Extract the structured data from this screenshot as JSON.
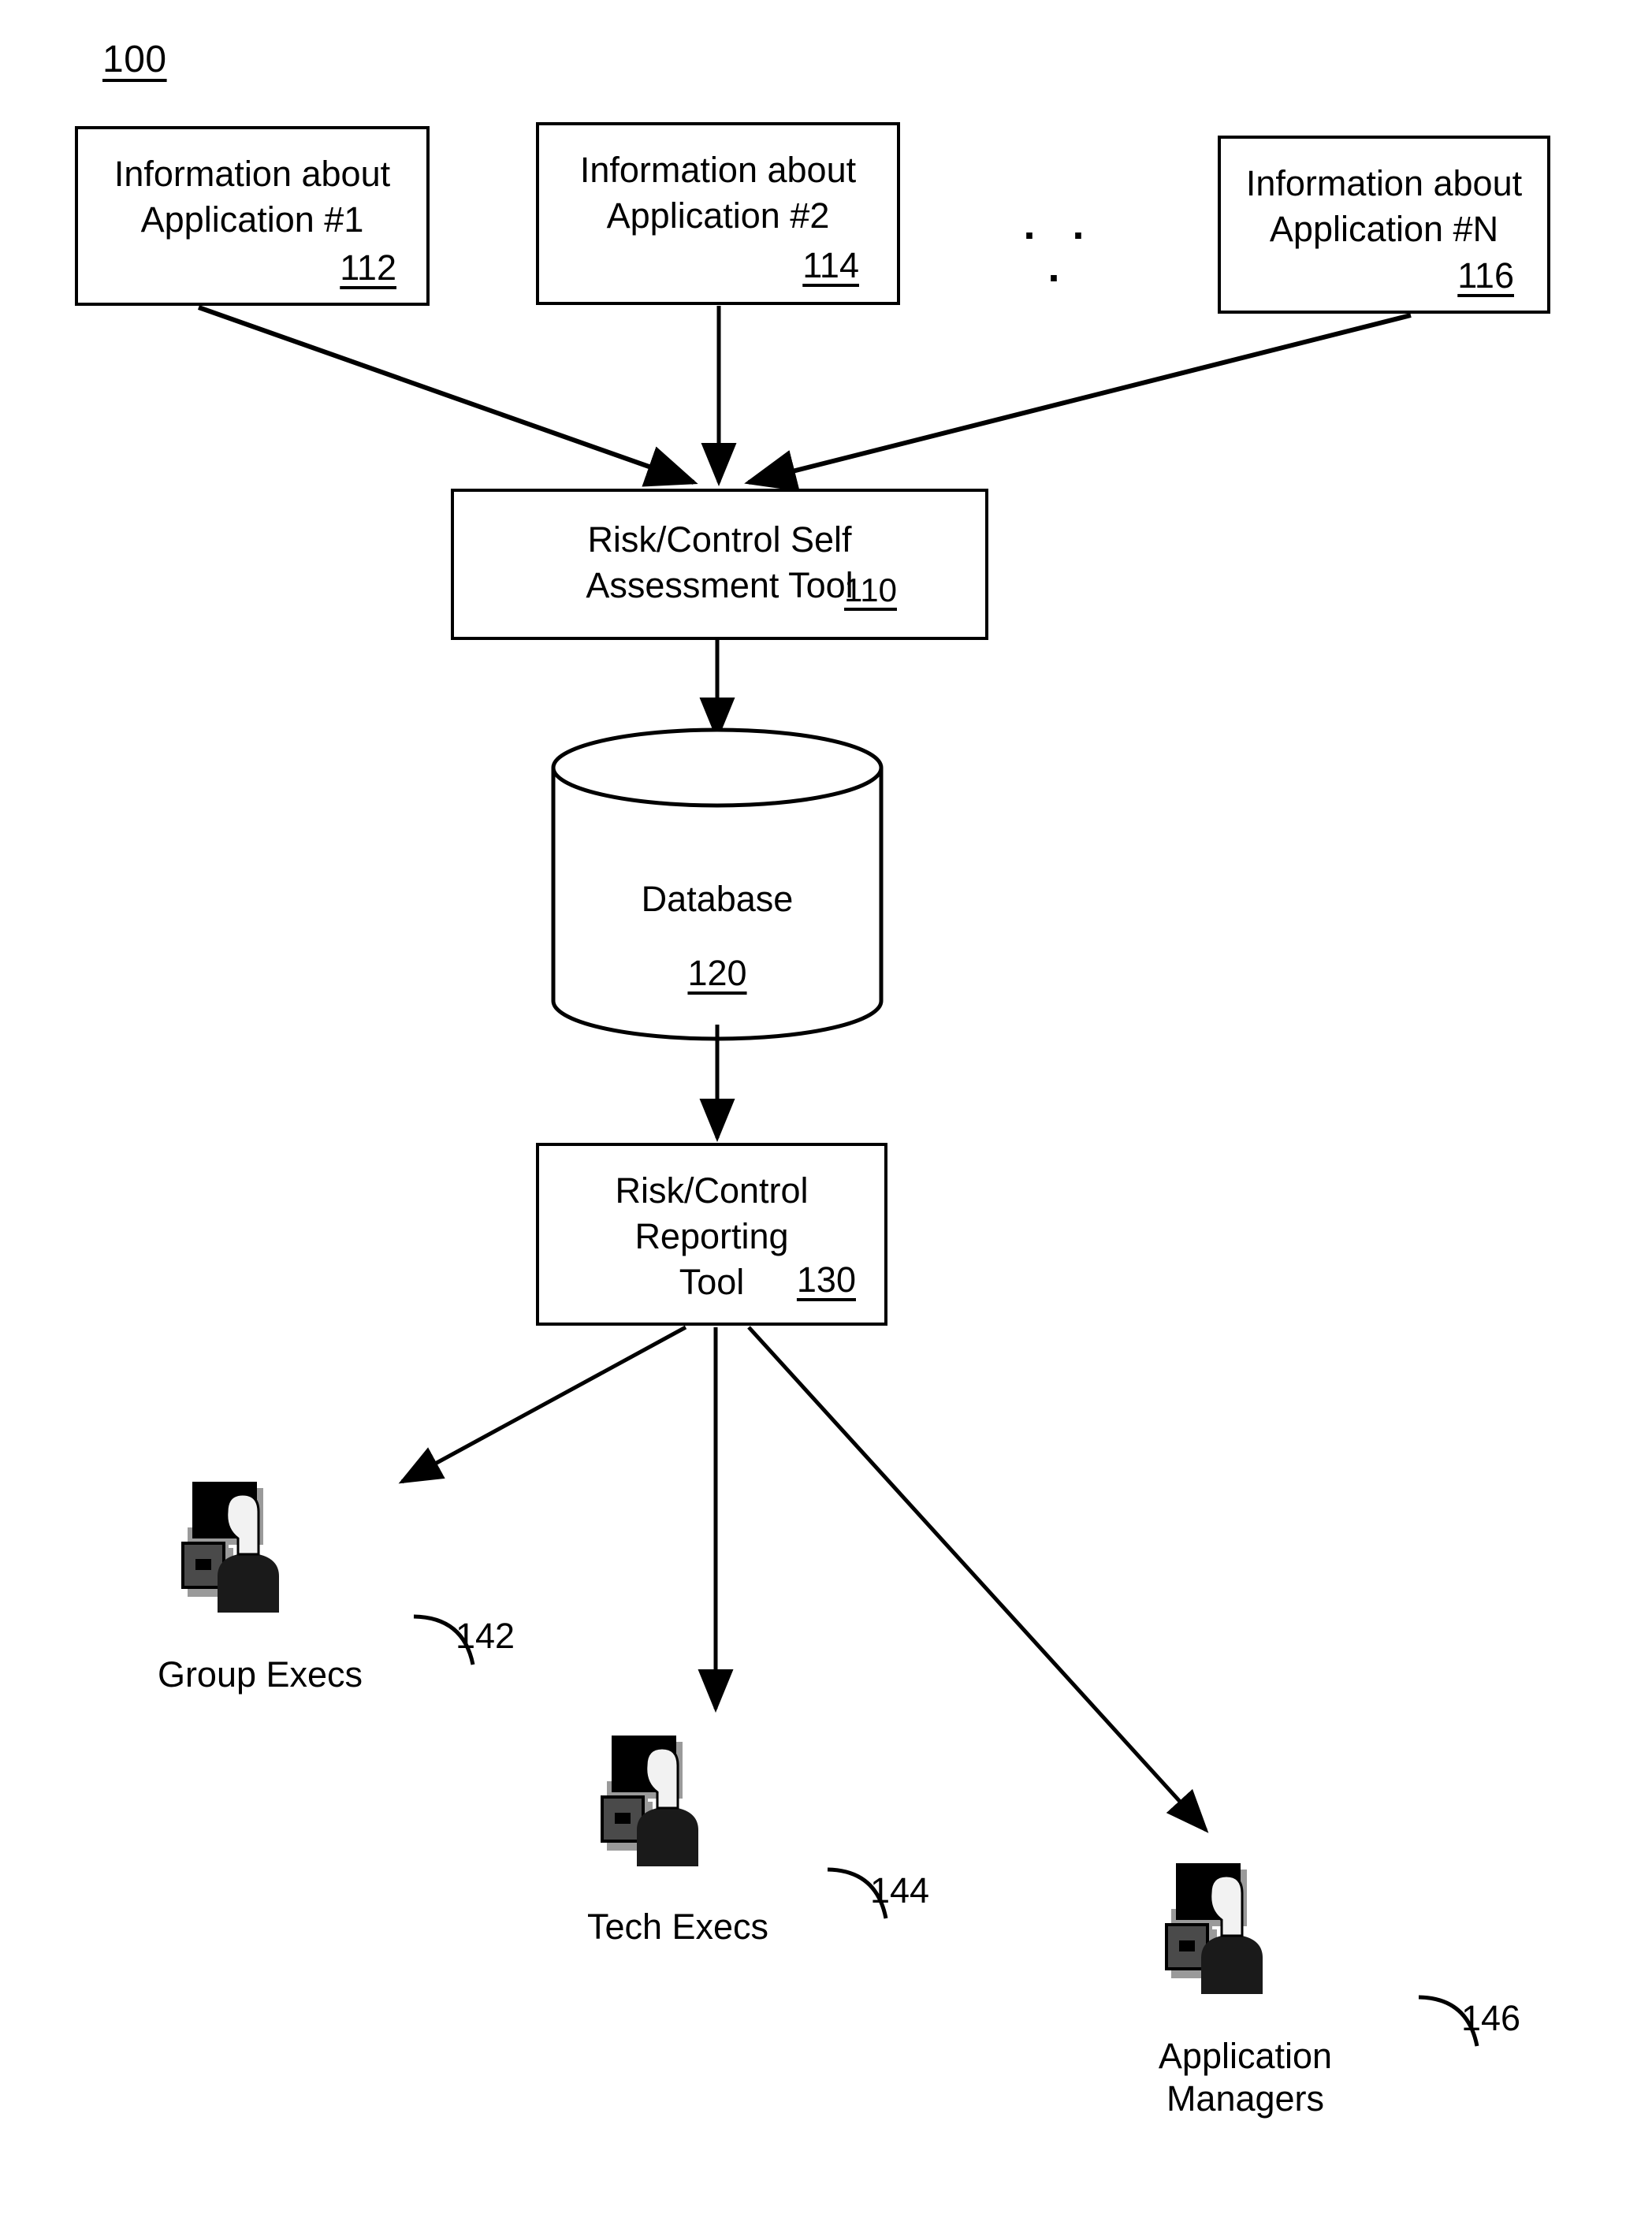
{
  "figure": {
    "number": "100"
  },
  "inputs": [
    {
      "id": "box-app1",
      "text": "Information about\nApplication #1",
      "ref": "112"
    },
    {
      "id": "box-app2",
      "text": "Information about\nApplication #2",
      "ref": "114"
    },
    {
      "id": "box-appn",
      "text": "Information about\nApplication #N",
      "ref": "116"
    }
  ],
  "ellipsis": ". . .",
  "assessment_tool": {
    "text": "Risk/Control Self\nAssessment Tool",
    "ref": "110"
  },
  "database": {
    "label": "Database",
    "ref": "120"
  },
  "reporting_tool": {
    "text": "Risk/Control\nReporting\nTool",
    "ref": "130"
  },
  "actors": [
    {
      "id": "group-execs",
      "label": "Group Execs",
      "ref": "142",
      "icon": "user-workstation-icon"
    },
    {
      "id": "tech-execs",
      "label": "Tech Execs",
      "ref": "144",
      "icon": "user-workstation-icon"
    },
    {
      "id": "application-managers",
      "label": "Application\nManagers",
      "ref": "146",
      "icon": "user-workstation-icon"
    }
  ],
  "colors": {
    "line": "#000000",
    "background": "#ffffff",
    "icon_dark": "#000000",
    "icon_shadow": "#9a9a9a"
  }
}
